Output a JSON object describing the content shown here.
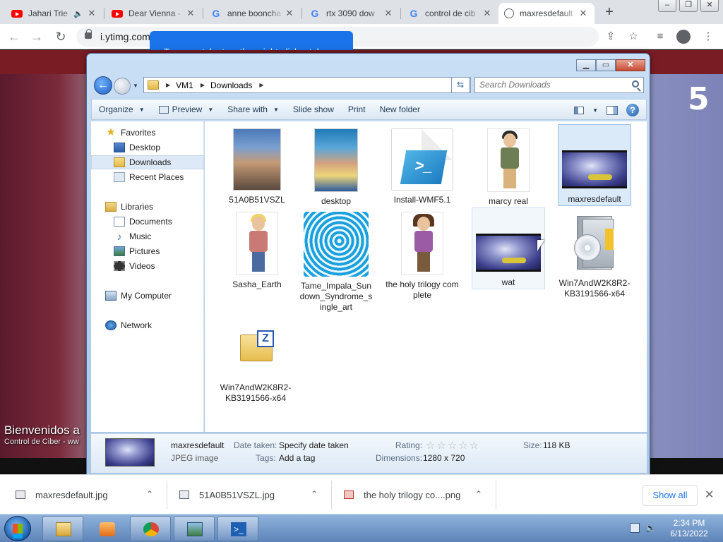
{
  "browser": {
    "tabs": [
      {
        "title": "Jahari Trie",
        "favicon": "youtube-icon",
        "audio": true
      },
      {
        "title": "Dear Vienna -",
        "favicon": "youtube-icon"
      },
      {
        "title": "anne booncha",
        "favicon": "google-icon"
      },
      {
        "title": "rtx 3090 dow",
        "favicon": "google-icon"
      },
      {
        "title": "control de cib",
        "favicon": "google-icon"
      },
      {
        "title": "maxresdefault",
        "favicon": "globe-icon",
        "active": true
      }
    ],
    "new_tab": "+",
    "window_buttons": [
      "–",
      "❐",
      "✕"
    ],
    "url": "i.ytimg.com",
    "tab_tooltip": "To group tabs together, right-click a tab"
  },
  "page": {
    "video_number": "5",
    "video_title": "Bienvenidos a",
    "video_subtitle": "Control de Ciber - ww"
  },
  "explorer": {
    "caption_buttons": [
      "▁",
      "▭",
      "✕"
    ],
    "breadcrumbs": [
      "VM1",
      "Downloads"
    ],
    "search_placeholder": "Search Downloads",
    "commands": [
      {
        "label": "Organize",
        "caret": true
      },
      {
        "label": "Preview",
        "caret": true,
        "icon": "preview-icon"
      },
      {
        "label": "Share with",
        "caret": true
      },
      {
        "label": "Slide show"
      },
      {
        "label": "Print"
      },
      {
        "label": "New folder"
      }
    ],
    "nav": {
      "favorites": "Favorites",
      "desktop": "Desktop",
      "downloads": "Downloads",
      "recent": "Recent Places",
      "libraries": "Libraries",
      "documents": "Documents",
      "music": "Music",
      "pictures": "Pictures",
      "videos": "Videos",
      "computer": "My Computer",
      "network": "Network"
    },
    "files": [
      {
        "name": "51A0B51VSZL"
      },
      {
        "name": "desktop"
      },
      {
        "name": "Install-WMF5.1"
      },
      {
        "name": "marcy real"
      },
      {
        "name": "maxresdefault",
        "selected": true
      },
      {
        "name": "Sasha_Earth"
      },
      {
        "name": "Tame_Impala_Sundown_Syndrome_single_art"
      },
      {
        "name": "the holy trilogy complete"
      },
      {
        "name": "wat",
        "hover": true
      },
      {
        "name": "Win7AndW2K8R2-KB3191566-x64"
      },
      {
        "name": "Win7AndW2K8R2-KB3191566-x64"
      }
    ],
    "details": {
      "name": "maxresdefault",
      "type": "JPEG image",
      "date_label": "Date taken:",
      "date_value": "Specify date taken",
      "tags_label": "Tags:",
      "tags_value": "Add a tag",
      "rating_label": "Rating:",
      "rating_stars": "☆☆☆☆☆",
      "dimensions_label": "Dimensions:",
      "dimensions_value": "1280 x 720",
      "size_label": "Size:",
      "size_value": "118 KB"
    }
  },
  "downloads_bar": {
    "items": [
      {
        "name": "maxresdefault.jpg"
      },
      {
        "name": "51A0B51VSZL.jpg"
      },
      {
        "name": "the holy trilogy co....png"
      }
    ],
    "show_all": "Show all",
    "close": "✕"
  },
  "taskbar": {
    "time": "2:34 PM",
    "date": "6/13/2022"
  }
}
